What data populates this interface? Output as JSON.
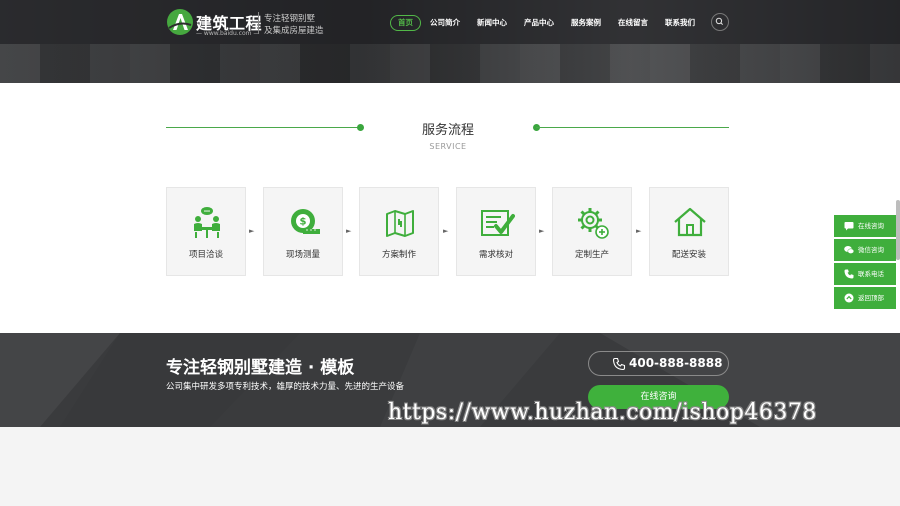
{
  "header": {
    "logo": {
      "mark": "A",
      "name": "建筑工程",
      "domain": "— www.baidu.com —",
      "tagline_1": "专注轻钢别墅",
      "tagline_2": "及集成房屋建造"
    },
    "nav": [
      {
        "label": "首页",
        "active": true
      },
      {
        "label": "公司简介",
        "active": false
      },
      {
        "label": "新闻中心",
        "active": false
      },
      {
        "label": "产品中心",
        "active": false
      },
      {
        "label": "服务案例",
        "active": false
      },
      {
        "label": "在线留言",
        "active": false
      },
      {
        "label": "联系我们",
        "active": false
      }
    ],
    "search_icon": "search-icon"
  },
  "service": {
    "title": "服务流程",
    "subtitle": "SERVICE",
    "steps": [
      {
        "label": "项目洽谈",
        "icon": "meeting-icon"
      },
      {
        "label": "现场测量",
        "icon": "tape-measure-icon"
      },
      {
        "label": "方案制作",
        "icon": "map-icon"
      },
      {
        "label": "需求核对",
        "icon": "checklist-icon"
      },
      {
        "label": "定制生产",
        "icon": "gear-icon"
      },
      {
        "label": "配送安装",
        "icon": "house-icon"
      }
    ],
    "arrow": "►"
  },
  "banner": {
    "title": "专注轻钢别墅建造 · 模板",
    "subtitle": "公司集中研发多项专利技术，雄厚的技术力量、先进的生产设备",
    "phone": "400-888-8888",
    "consult_label": "在线咨询"
  },
  "float_bar": [
    {
      "label": "在线咨询",
      "icon": "chat-icon"
    },
    {
      "label": "微信咨询",
      "icon": "wechat-icon"
    },
    {
      "label": "联系电话",
      "icon": "phone-icon"
    },
    {
      "label": "返回顶部",
      "icon": "arrow-up-icon"
    }
  ],
  "watermark": "https://www.huzhan.com/ishop46378",
  "colors": {
    "accent": "#3fb13c",
    "header_bg": "#2f3032",
    "banner_bg": "#3a3b3d"
  }
}
